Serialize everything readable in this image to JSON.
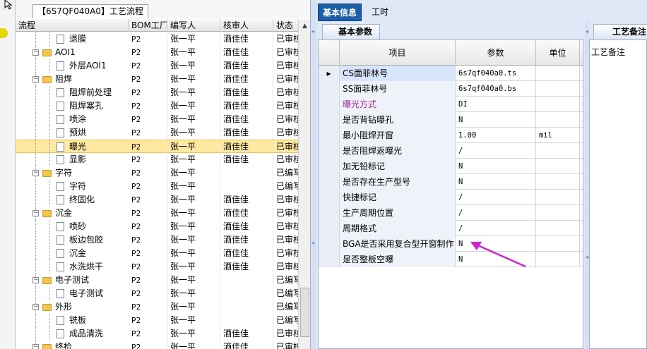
{
  "tree": {
    "process_tab_label": "【6S7QF040A0】工艺流程",
    "columns": [
      "流程",
      "BOM工厂",
      "编写人",
      "核审人",
      "状态"
    ],
    "rows": [
      {
        "name": "退膜",
        "type": "doc",
        "level": 2,
        "bom": "P2",
        "writer": "张一平",
        "reviewer": "酒佳佳",
        "status": "已审核"
      },
      {
        "name": "AOI1",
        "type": "folder",
        "level": 1,
        "bom": "P2",
        "writer": "张一平",
        "reviewer": "酒佳佳",
        "status": "已审核"
      },
      {
        "name": "外层AOI1",
        "type": "doc",
        "level": 2,
        "bom": "P2",
        "writer": "张一平",
        "reviewer": "酒佳佳",
        "status": "已审核"
      },
      {
        "name": "阻焊",
        "type": "folder",
        "level": 1,
        "bom": "P2",
        "writer": "张一平",
        "reviewer": "酒佳佳",
        "status": "已审核"
      },
      {
        "name": "阻焊前处理",
        "type": "doc",
        "level": 2,
        "bom": "P2",
        "writer": "张一平",
        "reviewer": "酒佳佳",
        "status": "已审核"
      },
      {
        "name": "阻焊塞孔",
        "type": "doc",
        "level": 2,
        "bom": "P2",
        "writer": "张一平",
        "reviewer": "酒佳佳",
        "status": "已审核"
      },
      {
        "name": "喷涂",
        "type": "doc",
        "level": 2,
        "bom": "P2",
        "writer": "张一平",
        "reviewer": "酒佳佳",
        "status": "已审核"
      },
      {
        "name": "预烘",
        "type": "doc",
        "level": 2,
        "bom": "P2",
        "writer": "张一平",
        "reviewer": "酒佳佳",
        "status": "已审核"
      },
      {
        "name": "曝光",
        "type": "doc",
        "level": 2,
        "bom": "P2",
        "writer": "张一平",
        "reviewer": "酒佳佳",
        "status": "已审核",
        "selected": true
      },
      {
        "name": "显影",
        "type": "doc",
        "level": 2,
        "bom": "P2",
        "writer": "张一平",
        "reviewer": "酒佳佳",
        "status": "已审核"
      },
      {
        "name": "字符",
        "type": "folder",
        "level": 1,
        "bom": "P2",
        "writer": "张一平",
        "reviewer": "",
        "status": "已编写"
      },
      {
        "name": "字符",
        "type": "doc",
        "level": 2,
        "bom": "P2",
        "writer": "张一平",
        "reviewer": "",
        "status": "已编写"
      },
      {
        "name": "终固化",
        "type": "doc",
        "level": 2,
        "bom": "P2",
        "writer": "张一平",
        "reviewer": "酒佳佳",
        "status": "已审核"
      },
      {
        "name": "沉金",
        "type": "folder",
        "level": 1,
        "bom": "P2",
        "writer": "张一平",
        "reviewer": "酒佳佳",
        "status": "已审核"
      },
      {
        "name": "喷砂",
        "type": "doc",
        "level": 2,
        "bom": "P2",
        "writer": "张一平",
        "reviewer": "酒佳佳",
        "status": "已审核"
      },
      {
        "name": "板边包胶",
        "type": "doc",
        "level": 2,
        "bom": "P2",
        "writer": "张一平",
        "reviewer": "酒佳佳",
        "status": "已审核"
      },
      {
        "name": "沉金",
        "type": "doc",
        "level": 2,
        "bom": "P2",
        "writer": "张一平",
        "reviewer": "酒佳佳",
        "status": "已审核"
      },
      {
        "name": "水洗烘干",
        "type": "doc",
        "level": 2,
        "bom": "P2",
        "writer": "张一平",
        "reviewer": "酒佳佳",
        "status": "已审核"
      },
      {
        "name": "电子测试",
        "type": "folder",
        "level": 1,
        "bom": "P2",
        "writer": "张一平",
        "reviewer": "",
        "status": "已编写"
      },
      {
        "name": "电子测试",
        "type": "doc",
        "level": 2,
        "bom": "P2",
        "writer": "张一平",
        "reviewer": "",
        "status": "已编写"
      },
      {
        "name": "外形",
        "type": "folder",
        "level": 1,
        "bom": "P2",
        "writer": "张一平",
        "reviewer": "",
        "status": "已编写"
      },
      {
        "name": "铣板",
        "type": "doc",
        "level": 2,
        "bom": "P2",
        "writer": "张一平",
        "reviewer": "",
        "status": "已编写"
      },
      {
        "name": "成品清洗",
        "type": "doc",
        "level": 2,
        "bom": "P2",
        "writer": "张一平",
        "reviewer": "酒佳佳",
        "status": "已审核"
      },
      {
        "name": "终检",
        "type": "folder",
        "level": 1,
        "bom": "P2",
        "writer": "张一平",
        "reviewer": "酒佳佳",
        "status": "已审核"
      }
    ]
  },
  "tabs": {
    "basic": "基本信息",
    "hours": "工时"
  },
  "params": {
    "tab_label": "基本参数",
    "headers": [
      "项目",
      "参数",
      "单位"
    ],
    "rows": [
      {
        "item": "CS面菲林号",
        "value": "6s7qf040a0.ts",
        "unit": "",
        "current": true
      },
      {
        "item": "SS面菲林号",
        "value": "6s7qf040a0.bs",
        "unit": ""
      },
      {
        "item": "曝光方式",
        "value": "DI",
        "unit": "",
        "highlight": true
      },
      {
        "item": "是否背钻曝孔",
        "value": "N",
        "unit": ""
      },
      {
        "item": "最小阻焊开窗",
        "value": "1.00",
        "unit": "mil"
      },
      {
        "item": "是否阻焊返曝光",
        "value": "/",
        "unit": ""
      },
      {
        "item": "加无铅标记",
        "value": "N",
        "unit": ""
      },
      {
        "item": "是否存在生产型号",
        "value": "N",
        "unit": ""
      },
      {
        "item": "快捷标记",
        "value": "/",
        "unit": ""
      },
      {
        "item": "生产周期位置",
        "value": "/",
        "unit": ""
      },
      {
        "item": "周期格式",
        "value": "/",
        "unit": ""
      },
      {
        "item": "BGA是否采用复合型开窗制作",
        "value": "N",
        "unit": ""
      },
      {
        "item": "是否整板空曝",
        "value": "N",
        "unit": ""
      }
    ]
  },
  "remarks": {
    "tab_label": "工艺备注",
    "label": "工艺备注"
  },
  "colors": {
    "accent_tab": "#1c5ea8",
    "highlight_text": "#a0289c",
    "annotation_arrow": "#d61fd0",
    "selected_row": "#ffe8a0"
  }
}
